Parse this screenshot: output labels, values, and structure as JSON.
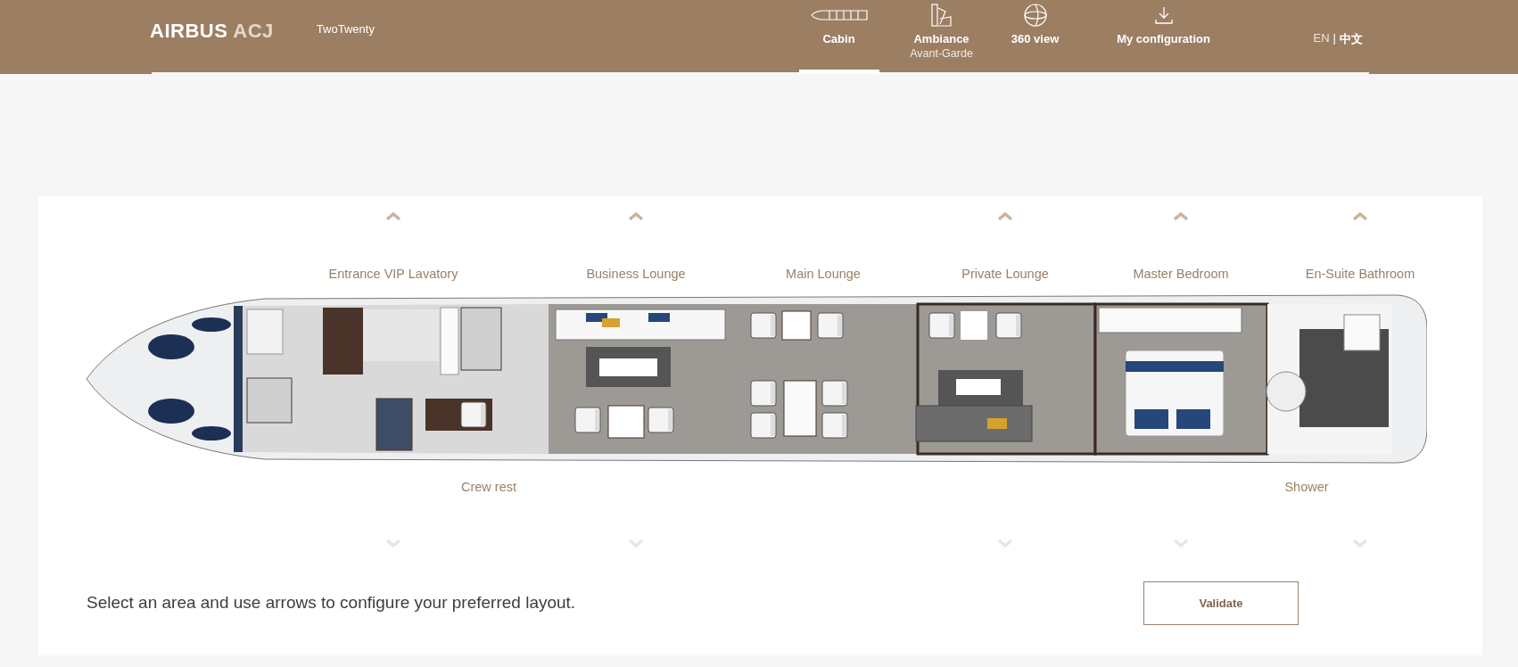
{
  "header": {
    "logo": {
      "primary": "AIRBUS",
      "secondary": "ACJ"
    },
    "model": "TwoTwenty",
    "nav": [
      {
        "label": "Cabin",
        "selected": true
      },
      {
        "label": "Ambiance",
        "sublabel": "Avant-Garde",
        "selected": false
      },
      {
        "label": "360 view",
        "selected": false
      },
      {
        "label": "My configuration",
        "selected": false
      }
    ],
    "languages": [
      {
        "label": "EN",
        "selected": false
      },
      {
        "label": "中文",
        "selected": true
      }
    ],
    "language_separator": "|"
  },
  "areas": [
    {
      "label": "Entrance VIP Lavatory",
      "arrows": {
        "up_disabled": false,
        "down_disabled": true
      }
    },
    {
      "label": "Business Lounge",
      "arrows": {
        "up_disabled": false,
        "down_disabled": true
      }
    },
    {
      "label": "Main Lounge"
    },
    {
      "label": "Private Lounge",
      "arrows": {
        "up_disabled": false,
        "down_disabled": true
      }
    },
    {
      "label": "Master Bedroom",
      "arrows": {
        "up_disabled": false,
        "down_disabled": true
      }
    },
    {
      "label": "En-Suite Bathroom",
      "arrows": {
        "up_disabled": false,
        "down_disabled": true
      }
    }
  ],
  "lower_areas": [
    {
      "label": "Crew rest"
    },
    {
      "label": "Shower"
    }
  ],
  "instruction": "Select an area and use arrows to configure your preferred layout.",
  "validate_button": "Validate"
}
